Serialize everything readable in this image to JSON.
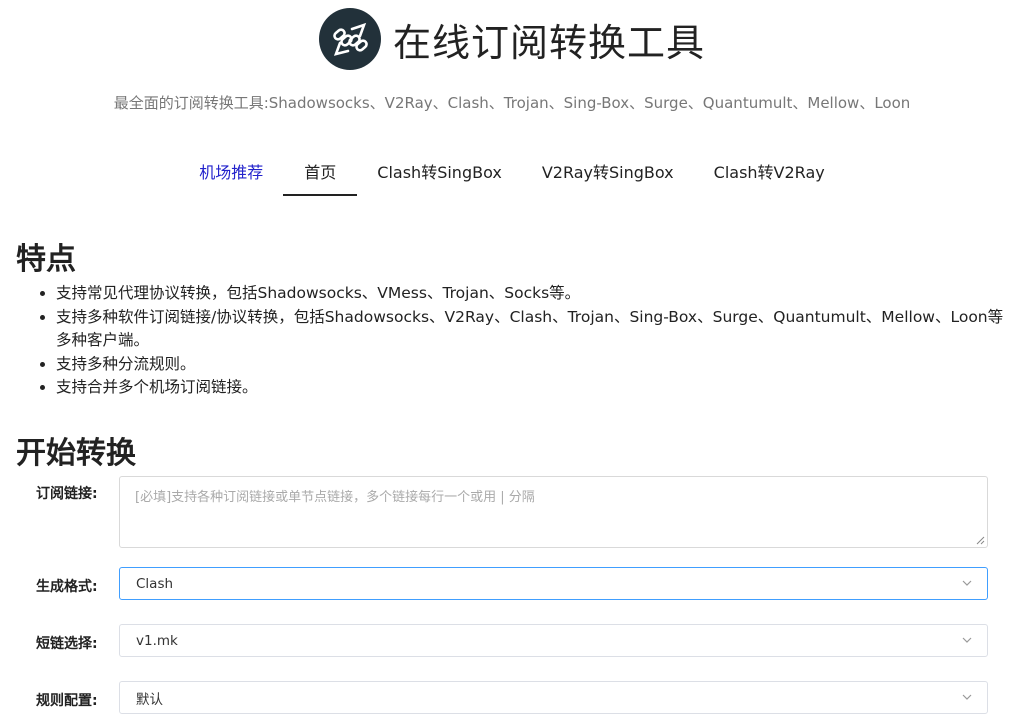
{
  "header": {
    "logo_icon": "chain-link-exchange-icon",
    "title": "在线订阅转换工具",
    "subtitle": "最全面的订阅转换工具:Shadowsocks、V2Ray、Clash、Trojan、Sing-Box、Surge、Quantumult、Mellow、Loon"
  },
  "nav": {
    "items": [
      {
        "label": "机场推荐"
      },
      {
        "label": "首页"
      },
      {
        "label": "Clash转SingBox"
      },
      {
        "label": "V2Ray转SingBox"
      },
      {
        "label": "Clash转V2Ray"
      }
    ],
    "active": "首页"
  },
  "features": {
    "title": "特点",
    "items": [
      "支持常见代理协议转换，包括Shadowsocks、VMess、Trojan、Socks等。",
      "支持多种软件订阅链接/协议转换，包括Shadowsocks、V2Ray、Clash、Trojan、Sing-Box、Surge、Quantumult、Mellow、Loon等多种客户端。",
      "支持多种分流规则。",
      "支持合并多个机场订阅链接。"
    ]
  },
  "convert": {
    "title": "开始转换",
    "subscription": {
      "label": "订阅链接:",
      "placeholder": "[必填]支持各种订阅链接或单节点链接，多个链接每行一个或用 | 分隔",
      "value": ""
    },
    "format": {
      "label": "生成格式:",
      "value": "Clash"
    },
    "short_link": {
      "label": "短链选择:",
      "value": "v1.mk"
    },
    "rules": {
      "label": "规则配置:",
      "value": "默认"
    }
  },
  "colors": {
    "promo_link": "#2222cc",
    "focus_border": "#409eff",
    "logo_bg": "#22313a"
  }
}
